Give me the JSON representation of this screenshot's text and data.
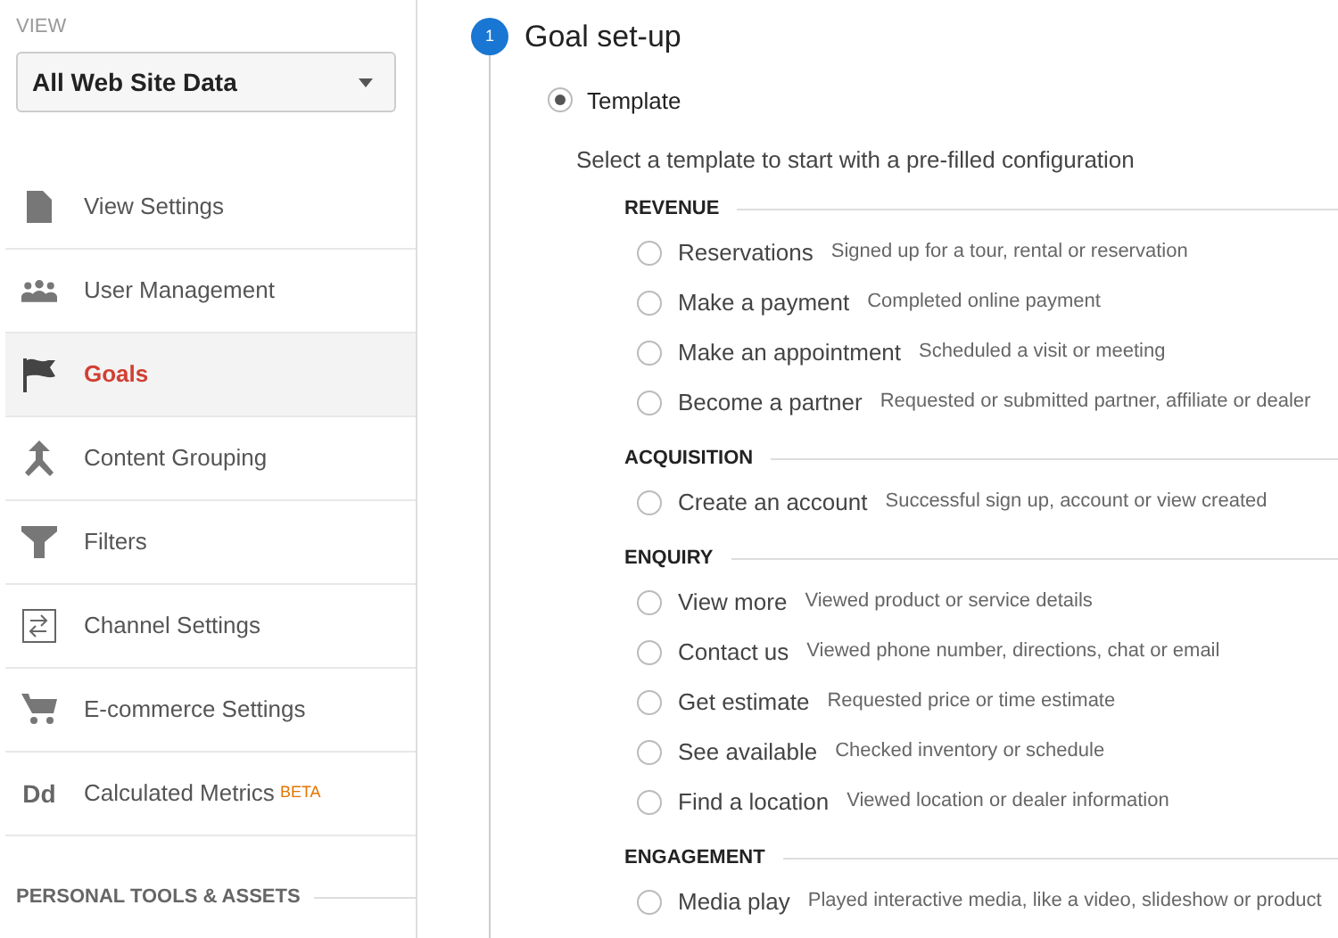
{
  "sidebar": {
    "view_label": "VIEW",
    "view_select": "All Web Site Data",
    "items": [
      {
        "label": "View Settings",
        "selected": false
      },
      {
        "label": "User Management",
        "selected": false
      },
      {
        "label": "Goals",
        "selected": true
      },
      {
        "label": "Content Grouping",
        "selected": false
      },
      {
        "label": "Filters",
        "selected": false
      },
      {
        "label": "Channel Settings",
        "selected": false
      },
      {
        "label": "E-commerce Settings",
        "selected": false
      },
      {
        "label": "Calculated Metrics",
        "icon_text": "Dd",
        "badge": "BETA",
        "selected": false
      }
    ],
    "section_heading": "PERSONAL TOOLS & ASSETS"
  },
  "step": {
    "number": "1",
    "title": "Goal set-up",
    "template_option": {
      "label": "Template",
      "selected": true
    },
    "hint": "Select a template to start with a pre-filled configuration",
    "groups": [
      {
        "heading": "REVENUE",
        "options": [
          {
            "label": "Reservations",
            "description": "Signed up for a tour, rental or reservation",
            "selected": false
          },
          {
            "label": "Make a payment",
            "description": "Completed online payment",
            "selected": false
          },
          {
            "label": "Make an appointment",
            "description": "Scheduled a visit or meeting",
            "selected": false
          },
          {
            "label": "Become a partner",
            "description": "Requested or submitted partner, affiliate or dealer",
            "selected": false
          }
        ]
      },
      {
        "heading": "ACQUISITION",
        "options": [
          {
            "label": "Create an account",
            "description": "Successful sign up, account or view created",
            "selected": false
          }
        ]
      },
      {
        "heading": "ENQUIRY",
        "options": [
          {
            "label": "View more",
            "description": "Viewed product or service details",
            "selected": false
          },
          {
            "label": "Contact us",
            "description": "Viewed phone number, directions, chat or email",
            "selected": false
          },
          {
            "label": "Get estimate",
            "description": "Requested price or time estimate",
            "selected": false
          },
          {
            "label": "See available",
            "description": "Checked inventory or schedule",
            "selected": false
          },
          {
            "label": "Find a location",
            "description": "Viewed location or dealer information",
            "selected": false
          }
        ]
      },
      {
        "heading": "ENGAGEMENT",
        "options": [
          {
            "label": "Media play",
            "description": "Played interactive media, like a video, slideshow or product",
            "selected": false
          }
        ]
      }
    ]
  }
}
